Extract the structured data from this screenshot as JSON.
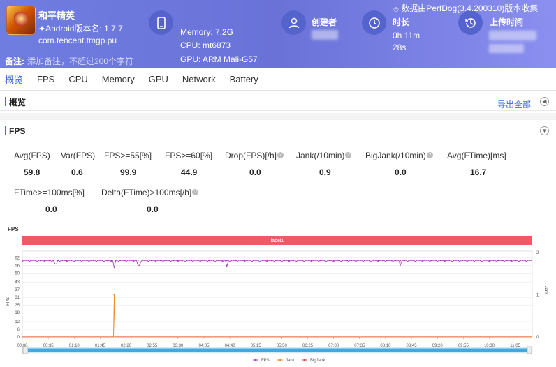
{
  "header": {
    "app_name": "和平精英",
    "version": "Android版本名: 1.7.7",
    "package": "com.tencent.tmgp.pu",
    "memory": "Memory: 7.2G",
    "cpu": "CPU: mt6873",
    "gpu": "GPU: ARM Mali-G57",
    "creator_label": "创建者",
    "duration_label": "时长",
    "duration_value_1": "0h 11m",
    "duration_value_2": "28s",
    "upload_label": "上传时间",
    "source_note": "数据由PerfDog(3.4.200310)版本收集",
    "note_label": "备注:",
    "note_placeholder": "添加备注，不超过200个字符"
  },
  "tabs": [
    "概览",
    "FPS",
    "CPU",
    "Memory",
    "GPU",
    "Network",
    "Battery"
  ],
  "overview": {
    "title": "概览",
    "export_label": "导出全部"
  },
  "fps_section": {
    "title": "FPS",
    "metrics": [
      {
        "label": "Avg(FPS)",
        "value": "59.8"
      },
      {
        "label": "Var(FPS)",
        "value": "0.6"
      },
      {
        "label": "FPS>=55[%]",
        "value": "99.9"
      },
      {
        "label": "FPS>=60[%]",
        "value": "44.9"
      },
      {
        "label": "Drop(FPS)[/h]",
        "value": "0.0"
      },
      {
        "label": "Jank(/10min)",
        "value": "0.9"
      },
      {
        "label": "BigJank(/10min)",
        "value": "0.0"
      },
      {
        "label": "Avg(FTime)[ms]",
        "value": "16.7"
      },
      {
        "label": "FTime>=100ms[%]",
        "value": "0.0"
      },
      {
        "label": "Delta(FTime)>100ms[/h]",
        "value": "0.0"
      }
    ]
  },
  "chart_data": {
    "type": "line",
    "title": "FPS",
    "label_band": "label1",
    "y_left_ticks": [
      "0",
      "6",
      "12",
      "19",
      "25",
      "31",
      "37",
      "43",
      "50",
      "56",
      "62"
    ],
    "y_left_label": "FPS",
    "y_right_ticks": [
      "0",
      "1",
      "2"
    ],
    "y_right_label": "Jank",
    "ylim_left": [
      0,
      66
    ],
    "ylim_right": [
      0,
      2
    ],
    "x_ticks": [
      "00:00",
      "00:35",
      "01:10",
      "01:45",
      "02:20",
      "02:55",
      "03:30",
      "04:05",
      "04:40",
      "05:15",
      "05:50",
      "06:25",
      "07:00",
      "07:35",
      "08:10",
      "08:45",
      "09:20",
      "09:55",
      "10:30",
      "11:05"
    ],
    "x_range_seconds": [
      0,
      688
    ],
    "series": [
      {
        "name": "FPS",
        "color": "#a335b8",
        "baseline": 59.8,
        "dips": [
          [
            45,
            57
          ],
          [
            124,
            54
          ],
          [
            157,
            56
          ],
          [
            276,
            55
          ],
          [
            510,
            56
          ]
        ]
      },
      {
        "name": "Jank",
        "color": "#f28c28",
        "spikes": [
          [
            124,
            1
          ]
        ]
      },
      {
        "name": "BigJank",
        "color": "#d9364a",
        "spikes": []
      }
    ],
    "grid": true,
    "legend_position": "bottom"
  },
  "colors": {
    "accent": "#3d6be0",
    "header": "#6f7de0",
    "label_band": "#ee5a65",
    "scrollbar": "#3fa9e0"
  },
  "icons": {
    "device": "phone-icon",
    "creator": "user-icon",
    "duration": "clock-icon",
    "upload": "history-icon",
    "export": "collapse-icon"
  }
}
